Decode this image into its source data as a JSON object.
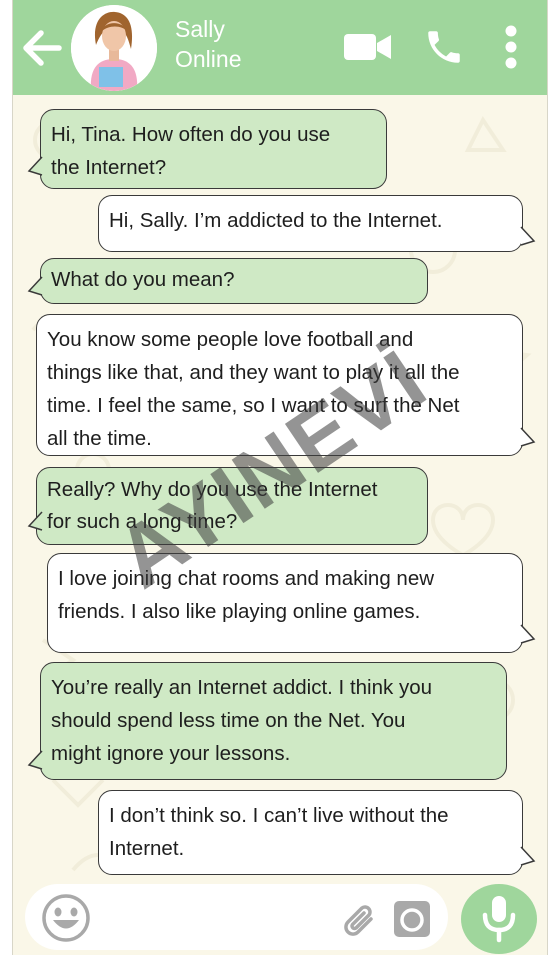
{
  "header": {
    "contact_name": "Sally",
    "contact_status": "Online",
    "icons": [
      "back-arrow-icon",
      "video-call-icon",
      "phone-call-icon",
      "more-options-icon"
    ]
  },
  "messages": [
    {
      "side": "incoming",
      "lines": [
        "Hi, Tina. How often do you use",
        "the Internet?"
      ]
    },
    {
      "side": "outgoing",
      "lines": [
        "Hi, Sally. I’m addicted to the Internet."
      ]
    },
    {
      "side": "incoming",
      "lines": [
        "What do you mean?"
      ]
    },
    {
      "side": "outgoing",
      "lines": [
        "You know some people love football and",
        "things like that, and they want to play it all the",
        "time. I feel the same, so I want to surf the Net",
        "all the time."
      ]
    },
    {
      "side": "incoming",
      "lines": [
        "Really? Why do you use the Internet",
        "for such a long time?"
      ]
    },
    {
      "side": "outgoing",
      "lines": [
        "I love joining chat rooms and making new",
        "friends. I also like playing online games."
      ]
    },
    {
      "side": "incoming",
      "lines": [
        "You’re really an Internet addict. I think you",
        "should spend less time on the Net. You",
        "might ignore your lessons."
      ]
    },
    {
      "side": "outgoing",
      "lines": [
        "I don’t think so. I can’t live without the",
        "Internet."
      ]
    }
  ],
  "input_bar": {
    "icons": [
      "emoji-icon",
      "attach-icon",
      "camera-icon",
      "microphone-icon"
    ]
  },
  "watermark": "AYINEVİ",
  "colors": {
    "header": "#9fd69c",
    "incoming_bubble": "#cfe9c5",
    "outgoing_bubble": "#ffffff",
    "chat_background": "#faf7e8"
  }
}
